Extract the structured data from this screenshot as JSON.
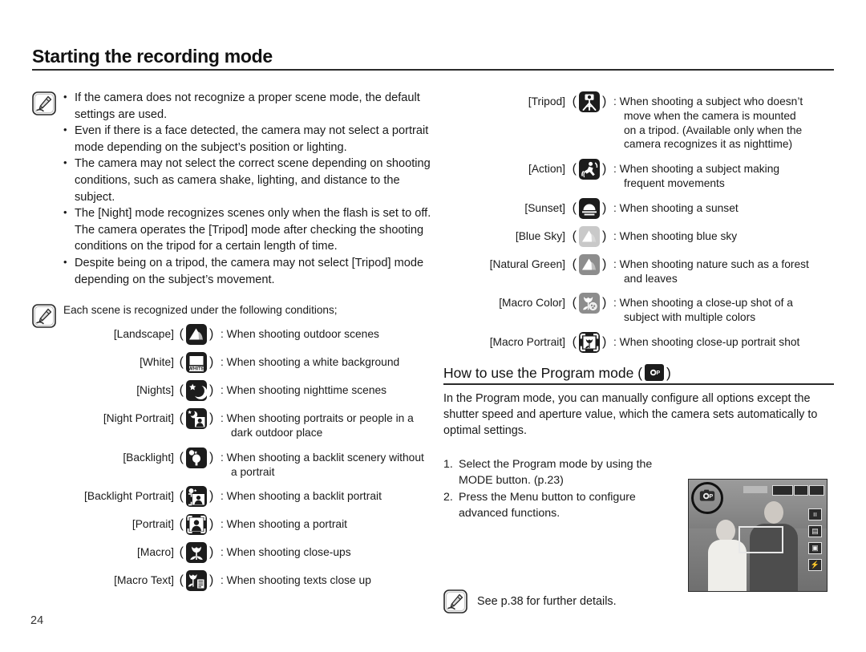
{
  "page": {
    "title": "Starting the recording mode",
    "number": "24"
  },
  "notes_top": {
    "icon": "note-pencil-icon",
    "bullets": [
      "If the camera does not recognize a proper scene mode, the default settings are used.",
      "Even if there is a face detected, the camera may not select a portrait mode depending on the subject’s position or lighting.",
      "The camera may not select the correct scene depending on shooting conditions, such as camera shake, lighting, and distance to the subject.",
      "The [Night] mode recognizes scenes only when the flash is set to off. The camera operates the [Tripod] mode after checking the shooting conditions on the tripod for a certain length of time.",
      "Despite being on a tripod, the camera may not select [Tripod] mode depending on the subject’s movement."
    ]
  },
  "scene_note": {
    "icon": "note-pencil-icon",
    "lead": "Each scene is recognized under the following conditions;"
  },
  "scenes_left": [
    {
      "label": "[Landscape]",
      "icon": "landscape-mountain-icon",
      "desc": "When shooting outdoor scenes",
      "desc2": ""
    },
    {
      "label": "[White]",
      "icon": "white-background-icon",
      "desc": "When shooting a white background",
      "desc2": ""
    },
    {
      "label": "[Nights]",
      "icon": "night-moon-star-icon",
      "desc": "When shooting nighttime scenes",
      "desc2": ""
    },
    {
      "label": "[Night Portrait]",
      "icon": "night-portrait-icon",
      "desc": "When shooting portraits or people in a",
      "desc2": "dark outdoor place"
    },
    {
      "label": "[Backlight]",
      "icon": "backlight-icon",
      "desc": "When shooting a backlit scenery without",
      "desc2": "a portrait"
    },
    {
      "label": "[Backlight Portrait]",
      "icon": "backlight-portrait-icon",
      "desc": "When shooting a backlit portrait",
      "desc2": ""
    },
    {
      "label": "[Portrait]",
      "icon": "portrait-icon",
      "desc": "When shooting a portrait",
      "desc2": ""
    },
    {
      "label": "[Macro]",
      "icon": "macro-flower-icon",
      "desc": "When shooting close-ups",
      "desc2": ""
    },
    {
      "label": "[Macro Text]",
      "icon": "macro-text-icon",
      "desc": "When shooting texts close up",
      "desc2": ""
    }
  ],
  "scenes_right": [
    {
      "label": "[Tripod]",
      "icon": "tripod-icon",
      "desc": "When shooting a subject who doesn’t",
      "desc2": "move when the camera is mounted",
      "desc3": "on a tripod. (Available only when the",
      "desc4": "camera recognizes it as nighttime)"
    },
    {
      "label": "[Action]",
      "icon": "action-running-icon",
      "desc": "When shooting a subject making",
      "desc2": "frequent movements"
    },
    {
      "label": "[Sunset]",
      "icon": "sunset-icon",
      "desc": "When shooting a sunset",
      "desc2": ""
    },
    {
      "label": "[Blue Sky]",
      "icon": "blue-sky-icon",
      "desc": "When shooting blue sky",
      "desc2": ""
    },
    {
      "label": "[Natural Green]",
      "icon": "natural-green-icon",
      "desc": "When shooting nature such as a forest",
      "desc2": "and leaves"
    },
    {
      "label": "[Macro Color]",
      "icon": "macro-color-icon",
      "desc": "When shooting a close-up shot of a",
      "desc2": "subject with multiple colors"
    },
    {
      "label": "[Macro Portrait]",
      "icon": "macro-portrait-icon",
      "desc": "When shooting close-up portrait shot",
      "desc2": ""
    }
  ],
  "program": {
    "heading_prefix": "How to use the Program mode (",
    "heading_suffix": ")",
    "heading_icon": "program-mode-camera-icon",
    "paragraph": "In the Program mode, you can manually configure all options except the shutter speed and aperture value, which the camera sets automatically to optimal settings.",
    "steps": [
      {
        "num": "1.",
        "text": "Select the Program mode by using the MODE button. (p.23)"
      },
      {
        "num": "2.",
        "text": "Press the Menu button to configure advanced functions."
      }
    ]
  },
  "see_note": {
    "icon": "note-pencil-icon",
    "text": "See p.38 for further details."
  },
  "lcd": {
    "mode_icon": "program-mode-camera-icon",
    "right_icons": [
      "iso-icon",
      "metering-icon",
      "focus-area-icon",
      "flash-icon"
    ],
    "focus_frame": "af-focus-frame"
  },
  "colors": {
    "ink": "#1a1a1a",
    "rule": "#2b2b2b",
    "icon_dark": "#1c1c1c",
    "icon_light": "#c9c9c9",
    "icon_mid": "#8d8d8d"
  }
}
